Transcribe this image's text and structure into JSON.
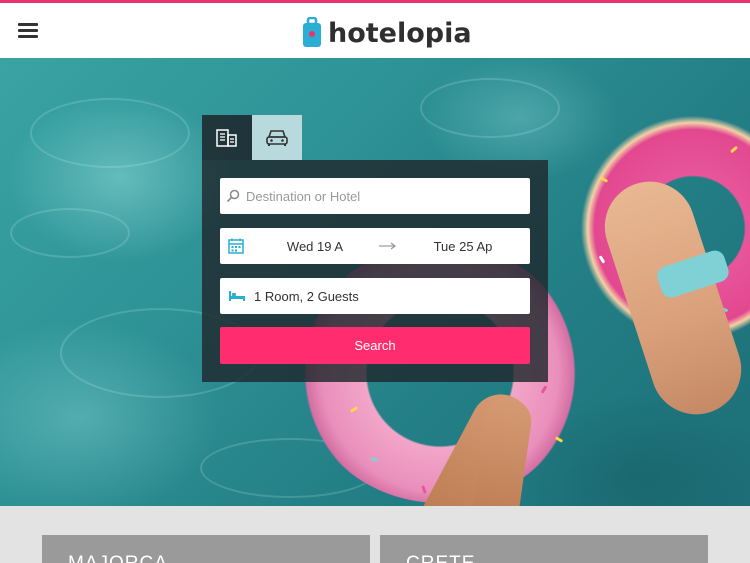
{
  "header": {
    "logo_text": "hotelopia",
    "menu_icon": "hamburger-icon",
    "accent_color": "#e8336f"
  },
  "search": {
    "tabs": [
      {
        "name": "hotels",
        "icon": "hotel-icon",
        "active": true
      },
      {
        "name": "cars",
        "icon": "car-icon",
        "active": false
      }
    ],
    "destination_placeholder": "Destination or Hotel",
    "checkin": "Wed 19 A",
    "checkout": "Tue 25 Ap",
    "guests": "1 Room, 2 Guests",
    "button_label": "Search",
    "button_color": "#ff2d6f",
    "icon_color": "#2aaed3"
  },
  "destinations": [
    {
      "label": "MAJORCA"
    },
    {
      "label": "CRETE"
    }
  ]
}
